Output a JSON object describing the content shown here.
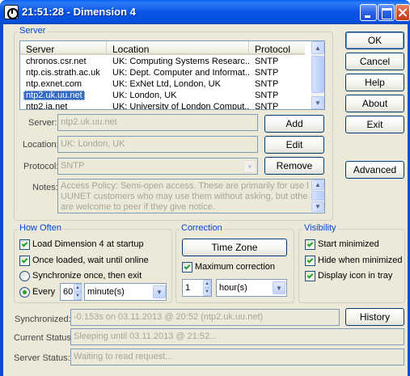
{
  "window": {
    "title": "21:51:28 - Dimension 4"
  },
  "server_group": {
    "title": "Server",
    "columns": [
      "Server",
      "Location",
      "Protocol"
    ],
    "rows": [
      {
        "server": "chronos.csr.net",
        "location": "UK: Computing Systems Researc...",
        "protocol": "SNTP"
      },
      {
        "server": "ntp.cis.strath.ac.uk",
        "location": "UK: Dept. Computer and Informat...",
        "protocol": "SNTP"
      },
      {
        "server": "ntp.exnet.com",
        "location": "UK: ExNet Ltd, London, UK",
        "protocol": "SNTP"
      },
      {
        "server": "ntp2.uk.uu.net",
        "location": "UK: London, UK",
        "protocol": "SNTP"
      },
      {
        "server": "ntp2.ja.net",
        "location": "UK: University of London Comput...",
        "protocol": "SNTP"
      }
    ],
    "selected_row": 3,
    "server_label": "Server:",
    "server_value": "ntp2.uk.uu.net",
    "location_label": "Location:",
    "location_value": "UK: London, UK",
    "protocol_label": "Protocol:",
    "protocol_value": "SNTP",
    "notes_label": "Notes:",
    "notes_lines": [
      "Access Policy: Semi-open access. These are primarily for use by",
      "UUNET customers who may use them without asking, but others",
      "are welcome to peer if they give notice."
    ],
    "add_label": "Add",
    "edit_label": "Edit",
    "remove_label": "Remove"
  },
  "side_buttons": {
    "ok": "OK",
    "cancel": "Cancel",
    "help": "Help",
    "about": "About",
    "exit": "Exit",
    "advanced": "Advanced"
  },
  "how_often": {
    "title": "How Often",
    "load_at_startup": {
      "label": "Load Dimension 4 at startup",
      "checked": true
    },
    "wait_until_online": {
      "label": "Once loaded, wait until online",
      "checked": true
    },
    "sync_once": {
      "label": "Synchronize once, then exit",
      "selected": false
    },
    "every": {
      "label": "Every",
      "selected": true
    },
    "every_value": "60",
    "every_unit": "minute(s)"
  },
  "correction": {
    "title": "Correction",
    "time_zone_label": "Time Zone",
    "max_correction": {
      "label": "Maximum correction",
      "checked": true
    },
    "max_value": "1",
    "max_unit": "hour(s)"
  },
  "visibility": {
    "title": "Visibility",
    "start_minimized": {
      "label": "Start minimized",
      "checked": true
    },
    "hide_when_minimized": {
      "label": "Hide when minimized",
      "checked": true
    },
    "display_icon_in_tray": {
      "label": "Display icon in tray",
      "checked": true
    }
  },
  "status": {
    "synchronized_label": "Synchronized:",
    "synchronized_value": "-0.153s on 03.11.2013 @ 20:52 (ntp2.uk.uu.net)",
    "history_label": "History",
    "current_status_label": "Current Status:",
    "current_status_value": "Sleeping until 03.11.2013 @ 21:52...",
    "server_status_label": "Server Status:",
    "server_status_value": "Waiting to read request..."
  },
  "colors": {
    "titlebar_blue": "#0754e6",
    "group_title": "#0046d5",
    "selection": "#316ac5",
    "check_green": "#21a121",
    "dialog_face": "#ece9d8"
  }
}
